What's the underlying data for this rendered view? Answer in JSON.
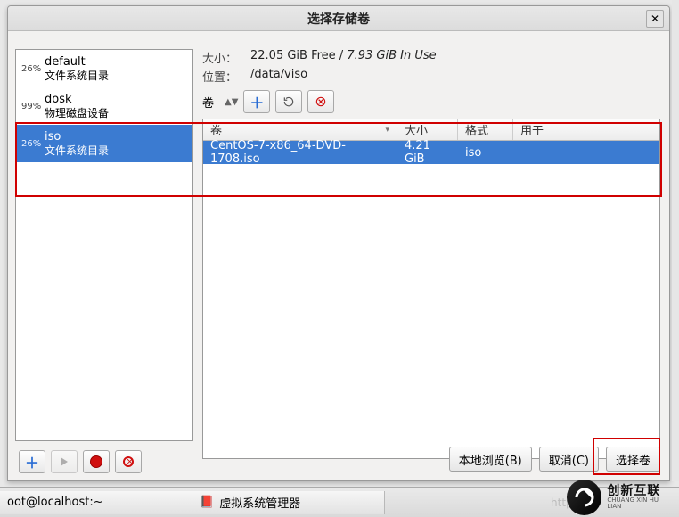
{
  "window": {
    "title": "选择存储卷",
    "close_glyph": "✕"
  },
  "pools": [
    {
      "pct": "26%",
      "name": "default",
      "type": "文件系统目录",
      "selected": false
    },
    {
      "pct": "99%",
      "name": "dosk",
      "type": "物理磁盘设备",
      "selected": false
    },
    {
      "pct": "26%",
      "name": "iso",
      "type": "文件系统目录",
      "selected": true
    }
  ],
  "details": {
    "size_label": "大小：",
    "size_free": "22.05 GiB Free",
    "size_sep": " / ",
    "size_inuse": "7.93 GiB In Use",
    "loc_label": "位置：",
    "loc_value": "/data/viso",
    "vol_label": "卷"
  },
  "columns": {
    "name": "卷",
    "size": "大小",
    "format": "格式",
    "used": "用于"
  },
  "rows": [
    {
      "name": "CentOS-7-x86_64-DVD-1708.iso",
      "size": "4.21 GiB",
      "format": "iso",
      "used": "",
      "selected": true
    }
  ],
  "toolbar_icons": {
    "add": "＋",
    "play": "▶",
    "record": "●",
    "delete": "⊘",
    "refresh": "⟳"
  },
  "footer": {
    "browse": "本地浏览(B)",
    "cancel": "取消(C)",
    "choose": "选择卷"
  },
  "taskbar": {
    "term": "oot@localhost:~",
    "vmm": "虚拟系统管理器",
    "watermark": "https://bl"
  },
  "brand": {
    "cn": "创新互联",
    "py": "CHUANG XIN HU LIAN"
  }
}
